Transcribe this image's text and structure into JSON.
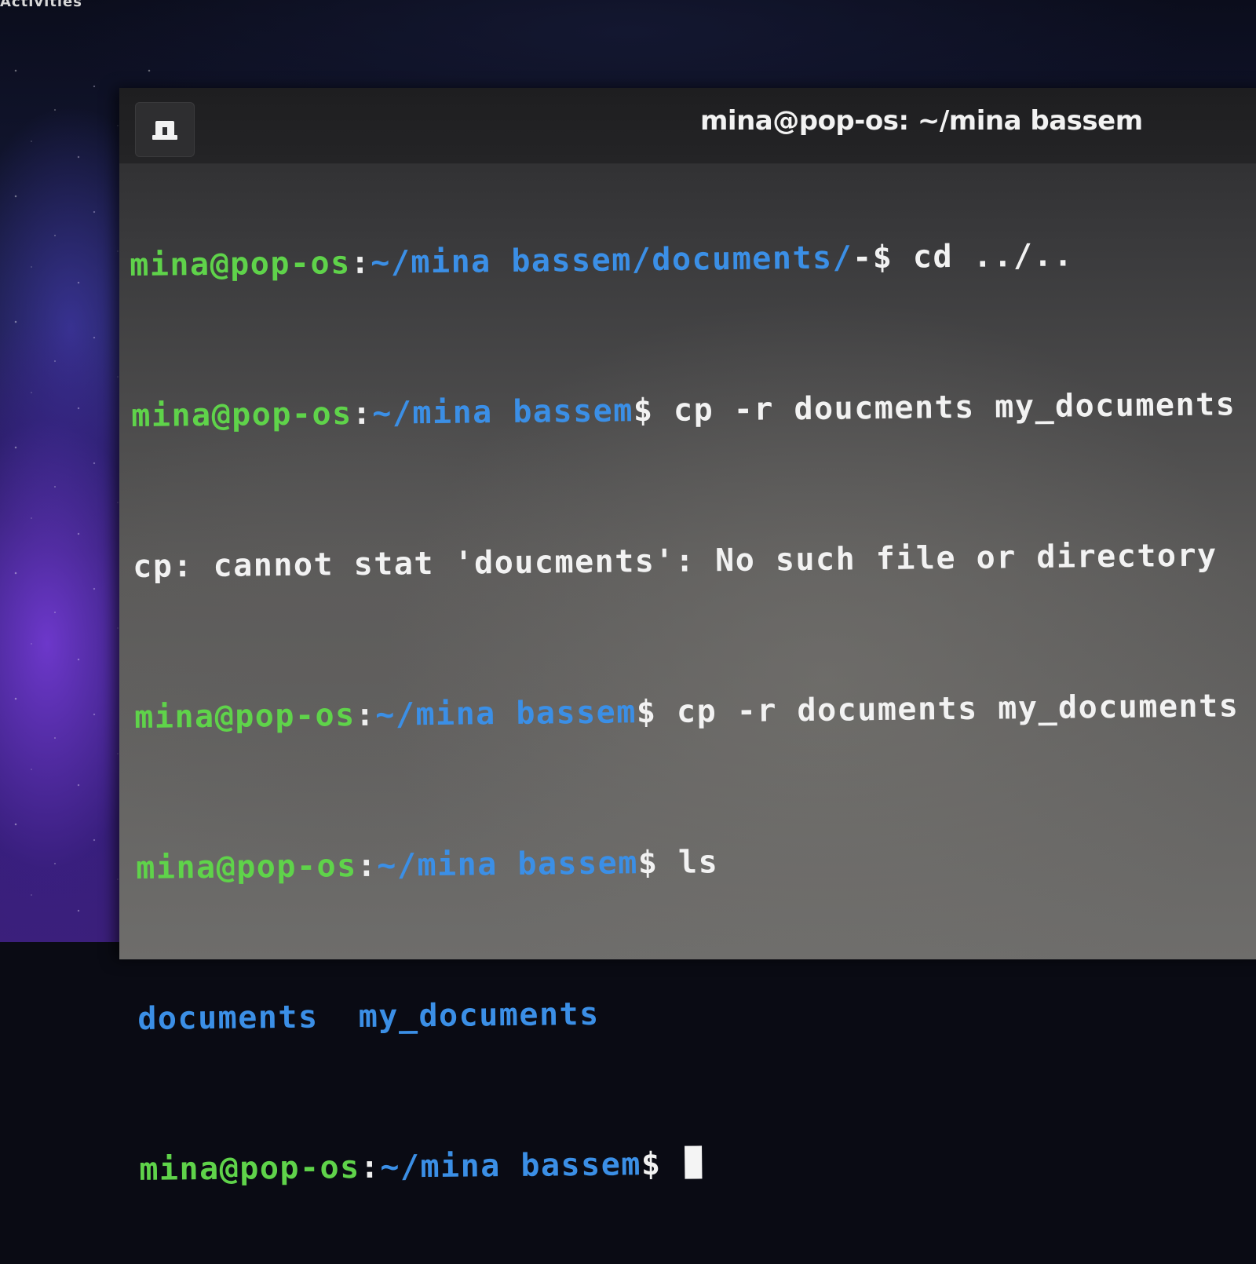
{
  "desktop": {
    "activities_label": "Activities"
  },
  "window": {
    "title": "mina@pop-os: ~/mina bassem",
    "new_tab_icon": "new-tab-icon"
  },
  "terminal": {
    "lines": [
      {
        "user": "mina@pop-os",
        "sep": ":",
        "path": "~/mina bassem/documents/",
        "prompt": "-$ ",
        "command": "cd ../.."
      },
      {
        "user": "mina@pop-os",
        "sep": ":",
        "path": "~/mina bassem",
        "prompt": "$ ",
        "command": "cp -r doucments my_documents"
      },
      {
        "output": "cp: cannot stat 'doucments': No such file or directory"
      },
      {
        "user": "mina@pop-os",
        "sep": ":",
        "path": "~/mina bassem",
        "prompt": "$ ",
        "command": "cp -r documents my_documents"
      },
      {
        "user": "mina@pop-os",
        "sep": ":",
        "path": "~/mina bassem",
        "prompt": "$ ",
        "command": "ls"
      },
      {
        "listing": [
          "documents",
          "my_documents"
        ]
      },
      {
        "user": "mina@pop-os",
        "sep": ":",
        "path": "~/mina bassem",
        "prompt": "$ ",
        "command": ""
      }
    ]
  },
  "colors": {
    "user": "#5fd34a",
    "path": "#3b8fe6",
    "text": "#f0f0f0"
  }
}
